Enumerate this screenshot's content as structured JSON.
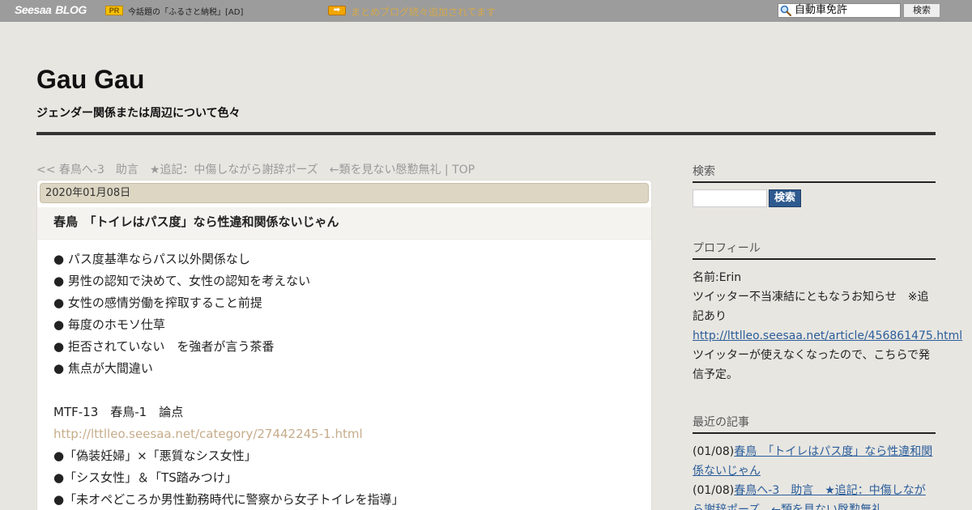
{
  "topbar": {
    "logo_seesaa": "Seesaa",
    "logo_blog": "BLOG",
    "pr_badge": "PR",
    "pr_text": "今話題の「ふるさと納税」[AD]",
    "arrow": "➡",
    "notice": "まとめブログ続々追加されてます",
    "search_value": "自動車免許",
    "search_button": "検索"
  },
  "header": {
    "title": "Gau Gau",
    "description": "ジェンダー関係または周辺について色々"
  },
  "nav": {
    "prev": "<< 春鳥へ-3　助言　★追記：中傷しながら謝辞ポーズ　←類を見ない慇懃無礼",
    "separator": " | ",
    "top": "TOP"
  },
  "article": {
    "date": "2020年01月08日",
    "title": "春鳥　「トイレはパス度」なら性違和関係ないじゃん",
    "bullets1": [
      "● パス度基準ならパス以外関係なし",
      "● 男性の認知で決めて、女性の認知を考えない",
      "● 女性の感情労働を搾取すること前提",
      "● 毎度のホモソ仕草",
      "● 拒否されていない　を強者が言う茶番",
      "● 焦点が大間違い"
    ],
    "section_title": "MTF-13　春鳥-1　論点",
    "link": "http://lttlleo.seesaa.net/category/27442245-1.html",
    "bullets2": [
      "●「偽装妊婦」×「悪質なシス女性」",
      "●「シス女性」＆「TS踏みつけ」",
      "●「未オペどころか男性勤務時代に警察から女子トイレを指導」"
    ]
  },
  "sidebar": {
    "search_heading": "検索",
    "search_button": "検索",
    "profile_heading": "プロフィール",
    "profile_name": "名前:Erin",
    "profile_notice": "ツイッター不当凍結にともなうお知らせ　※追記あり",
    "profile_link": "http://lttlleo.seesaa.net/article/456861475.html",
    "profile_note": "ツイッターが使えなくなったので、こちらで発信予定。",
    "recent_heading": "最近の記事",
    "recent": [
      {
        "date": "(01/08)",
        "title": "春鳥　「トイレはパス度」なら性違和関係ないじゃん"
      },
      {
        "date": "(01/08)",
        "title": "春鳥へ-3　助言　★追記：中傷しながら謝辞ポーズ　←類を見ない慇懃無礼"
      }
    ]
  }
}
